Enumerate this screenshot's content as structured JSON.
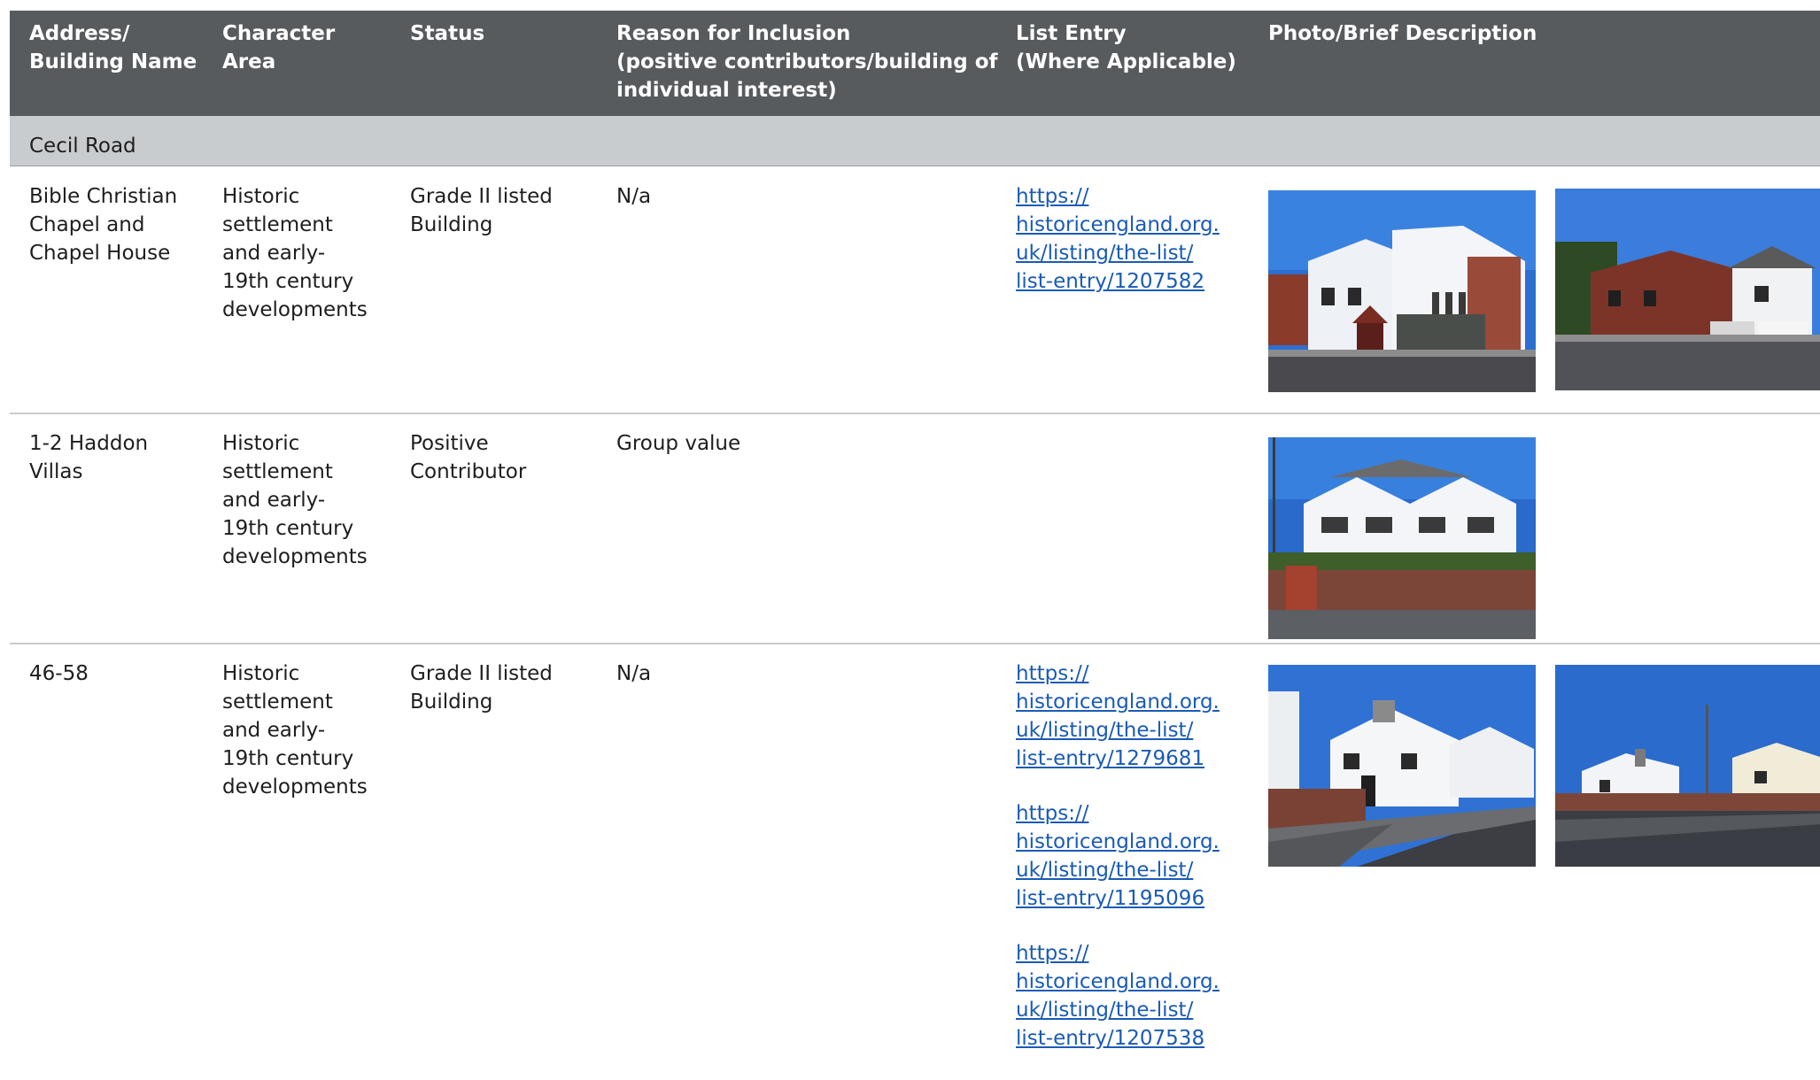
{
  "headers": {
    "address": [
      "Address/",
      "Building Name"
    ],
    "character_area": [
      "Character",
      "Area"
    ],
    "status": [
      "Status"
    ],
    "reason": [
      "Reason for Inclusion",
      "(positive contributors/building of",
      "individual interest)"
    ],
    "list_entry": [
      "List Entry",
      "(Where Applicable)"
    ],
    "photo": [
      "Photo/Brief Description"
    ]
  },
  "section": {
    "label": "Cecil Road"
  },
  "rows": [
    {
      "address": [
        "Bible Christian",
        "Chapel and",
        "Chapel House"
      ],
      "area": [
        "Historic",
        "settlement",
        "and early-",
        "19th century",
        "developments"
      ],
      "status": [
        "Grade II listed",
        "Building"
      ],
      "reason": "N/a",
      "links": [
        [
          "https://",
          "historicengland.org.",
          "uk/listing/the-list/",
          "list-entry/1207582"
        ]
      ],
      "photos": [
        "chapel-photo-icon",
        "street-house-photo-icon"
      ]
    },
    {
      "address": [
        "1-2 Haddon",
        "Villas"
      ],
      "area": [
        "Historic",
        "settlement",
        "and early-",
        "19th century",
        "developments"
      ],
      "status": [
        "Positive",
        "Contributor"
      ],
      "reason": "Group value",
      "links": [],
      "photos": [
        "villas-photo-icon"
      ]
    },
    {
      "address": [
        "46-58"
      ],
      "area": [
        "Historic",
        "settlement",
        "and early-",
        "19th century",
        "developments"
      ],
      "status": [
        "Grade II listed",
        "Building"
      ],
      "reason": "N/a",
      "links": [
        [
          "https://",
          "historicengland.org.",
          "uk/listing/the-list/",
          "list-entry/1279681"
        ],
        [
          "https://",
          "historicengland.org.",
          "uk/listing/the-list/",
          "list-entry/1195096"
        ],
        [
          "https://",
          "historicengland.org.",
          "uk/listing/the-list/",
          "list-entry/1207538"
        ]
      ],
      "photos": [
        "terrace-photo-icon",
        "terrace-street-photo-icon"
      ]
    }
  ],
  "colors": {
    "header_bg": "#575b5e",
    "section_bg": "#c9cccf",
    "link": "#1a5bb5",
    "sky": "#2f6fcf"
  }
}
